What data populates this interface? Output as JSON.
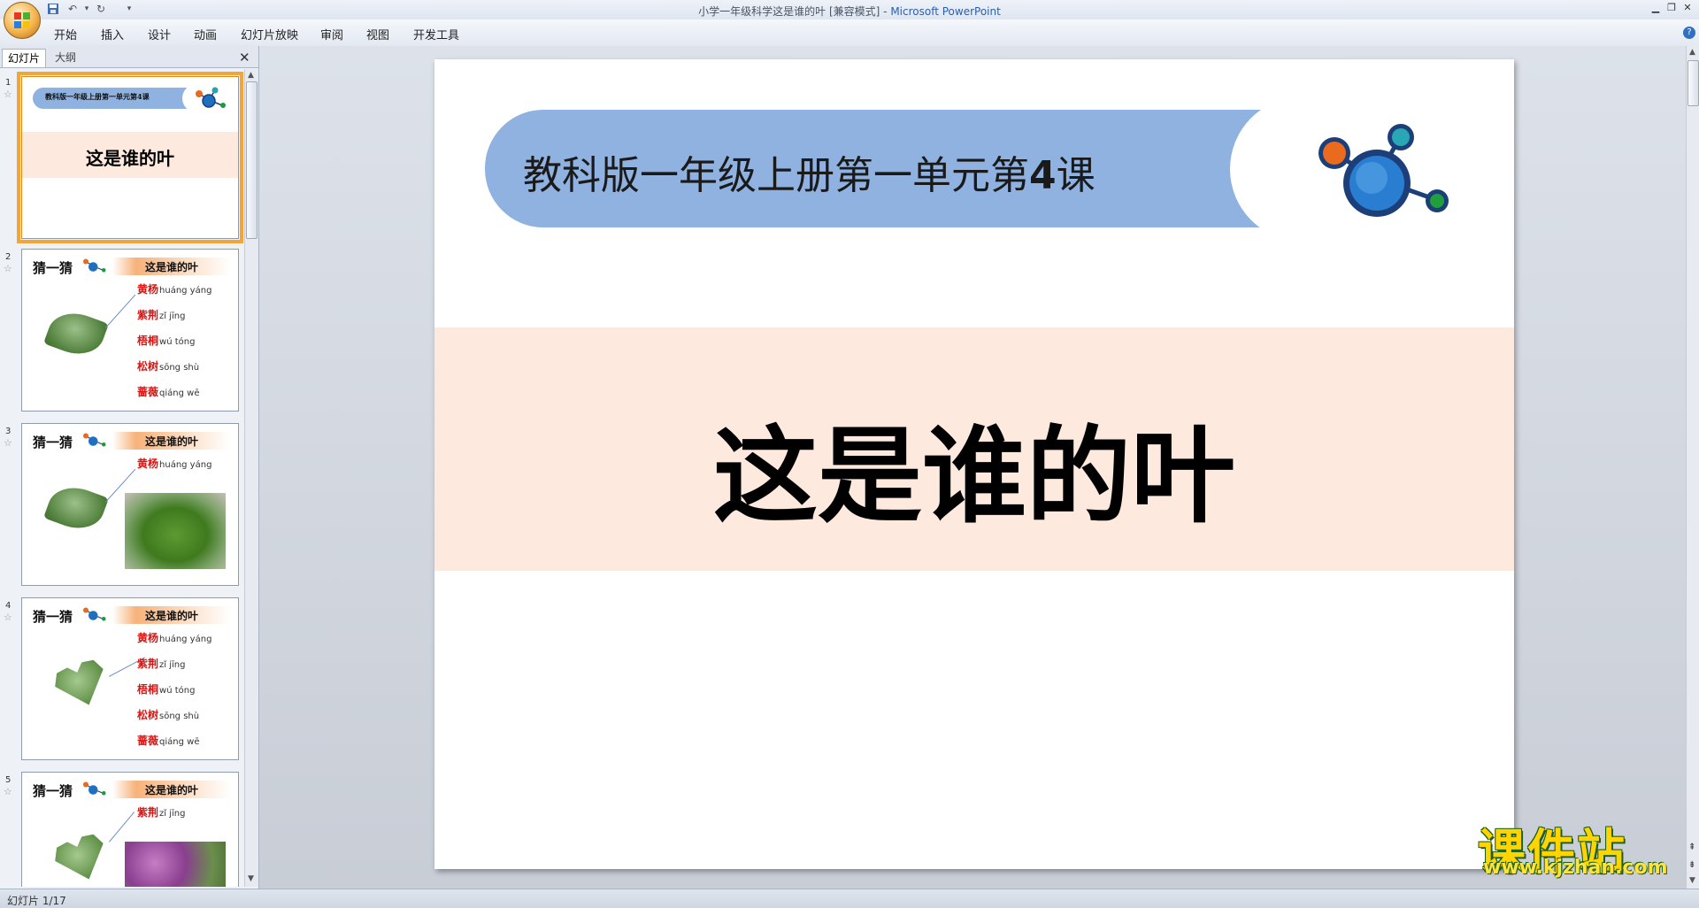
{
  "window": {
    "title_doc": "小学一年级科学这是谁的叶 [兼容模式] - ",
    "title_app": "Microsoft PowerPoint"
  },
  "ribbon": {
    "tabs": [
      "开始",
      "插入",
      "设计",
      "动画",
      "幻灯片放映",
      "审阅",
      "视图",
      "开发工具"
    ]
  },
  "pane": {
    "tab_slides": "幻灯片",
    "tab_outline": "大纲"
  },
  "thumbnails": [
    {
      "num": "1",
      "subtitle": "教科版一年级上册第一单元第4课",
      "title": "这是谁的叶"
    },
    {
      "num": "2",
      "guess": "猜一猜",
      "band": "这是谁的叶",
      "words": [
        {
          "cn": "黄杨",
          "py": "huáng yáng"
        },
        {
          "cn": "紫荆",
          "py": "zǐ  jīng"
        },
        {
          "cn": "梧桐",
          "py": "wú tóng"
        },
        {
          "cn": "松树",
          "py": "sōng shù"
        },
        {
          "cn": "蔷薇",
          "py": "qiáng wē"
        }
      ]
    },
    {
      "num": "3",
      "guess": "猜一猜",
      "band": "这是谁的叶",
      "words": [
        {
          "cn": "黄杨",
          "py": "huáng yáng"
        }
      ]
    },
    {
      "num": "4",
      "guess": "猜一猜",
      "band": "这是谁的叶",
      "words": [
        {
          "cn": "黄杨",
          "py": "huáng yáng"
        },
        {
          "cn": "紫荆",
          "py": "zǐ  jīng"
        },
        {
          "cn": "梧桐",
          "py": "wú tóng"
        },
        {
          "cn": "松树",
          "py": "sōng shù"
        },
        {
          "cn": "蔷薇",
          "py": "qiáng wē"
        }
      ]
    },
    {
      "num": "5",
      "guess": "猜一猜",
      "band": "这是谁的叶",
      "words": [
        {
          "cn": "紫荆",
          "py": "zǐ  jīng"
        }
      ]
    }
  ],
  "slide": {
    "subtitle_prefix": "教科版一年级上册第一单元第",
    "subtitle_num": "4",
    "subtitle_suffix": "课",
    "title": "这是谁的叶",
    "colors": {
      "band": "#8fb2e0",
      "title_band": "#fde9dd"
    }
  },
  "status": {
    "text": "幻灯片 1/17"
  },
  "watermark": {
    "cn": "课件站",
    "url": "www.kjzhan.com"
  }
}
